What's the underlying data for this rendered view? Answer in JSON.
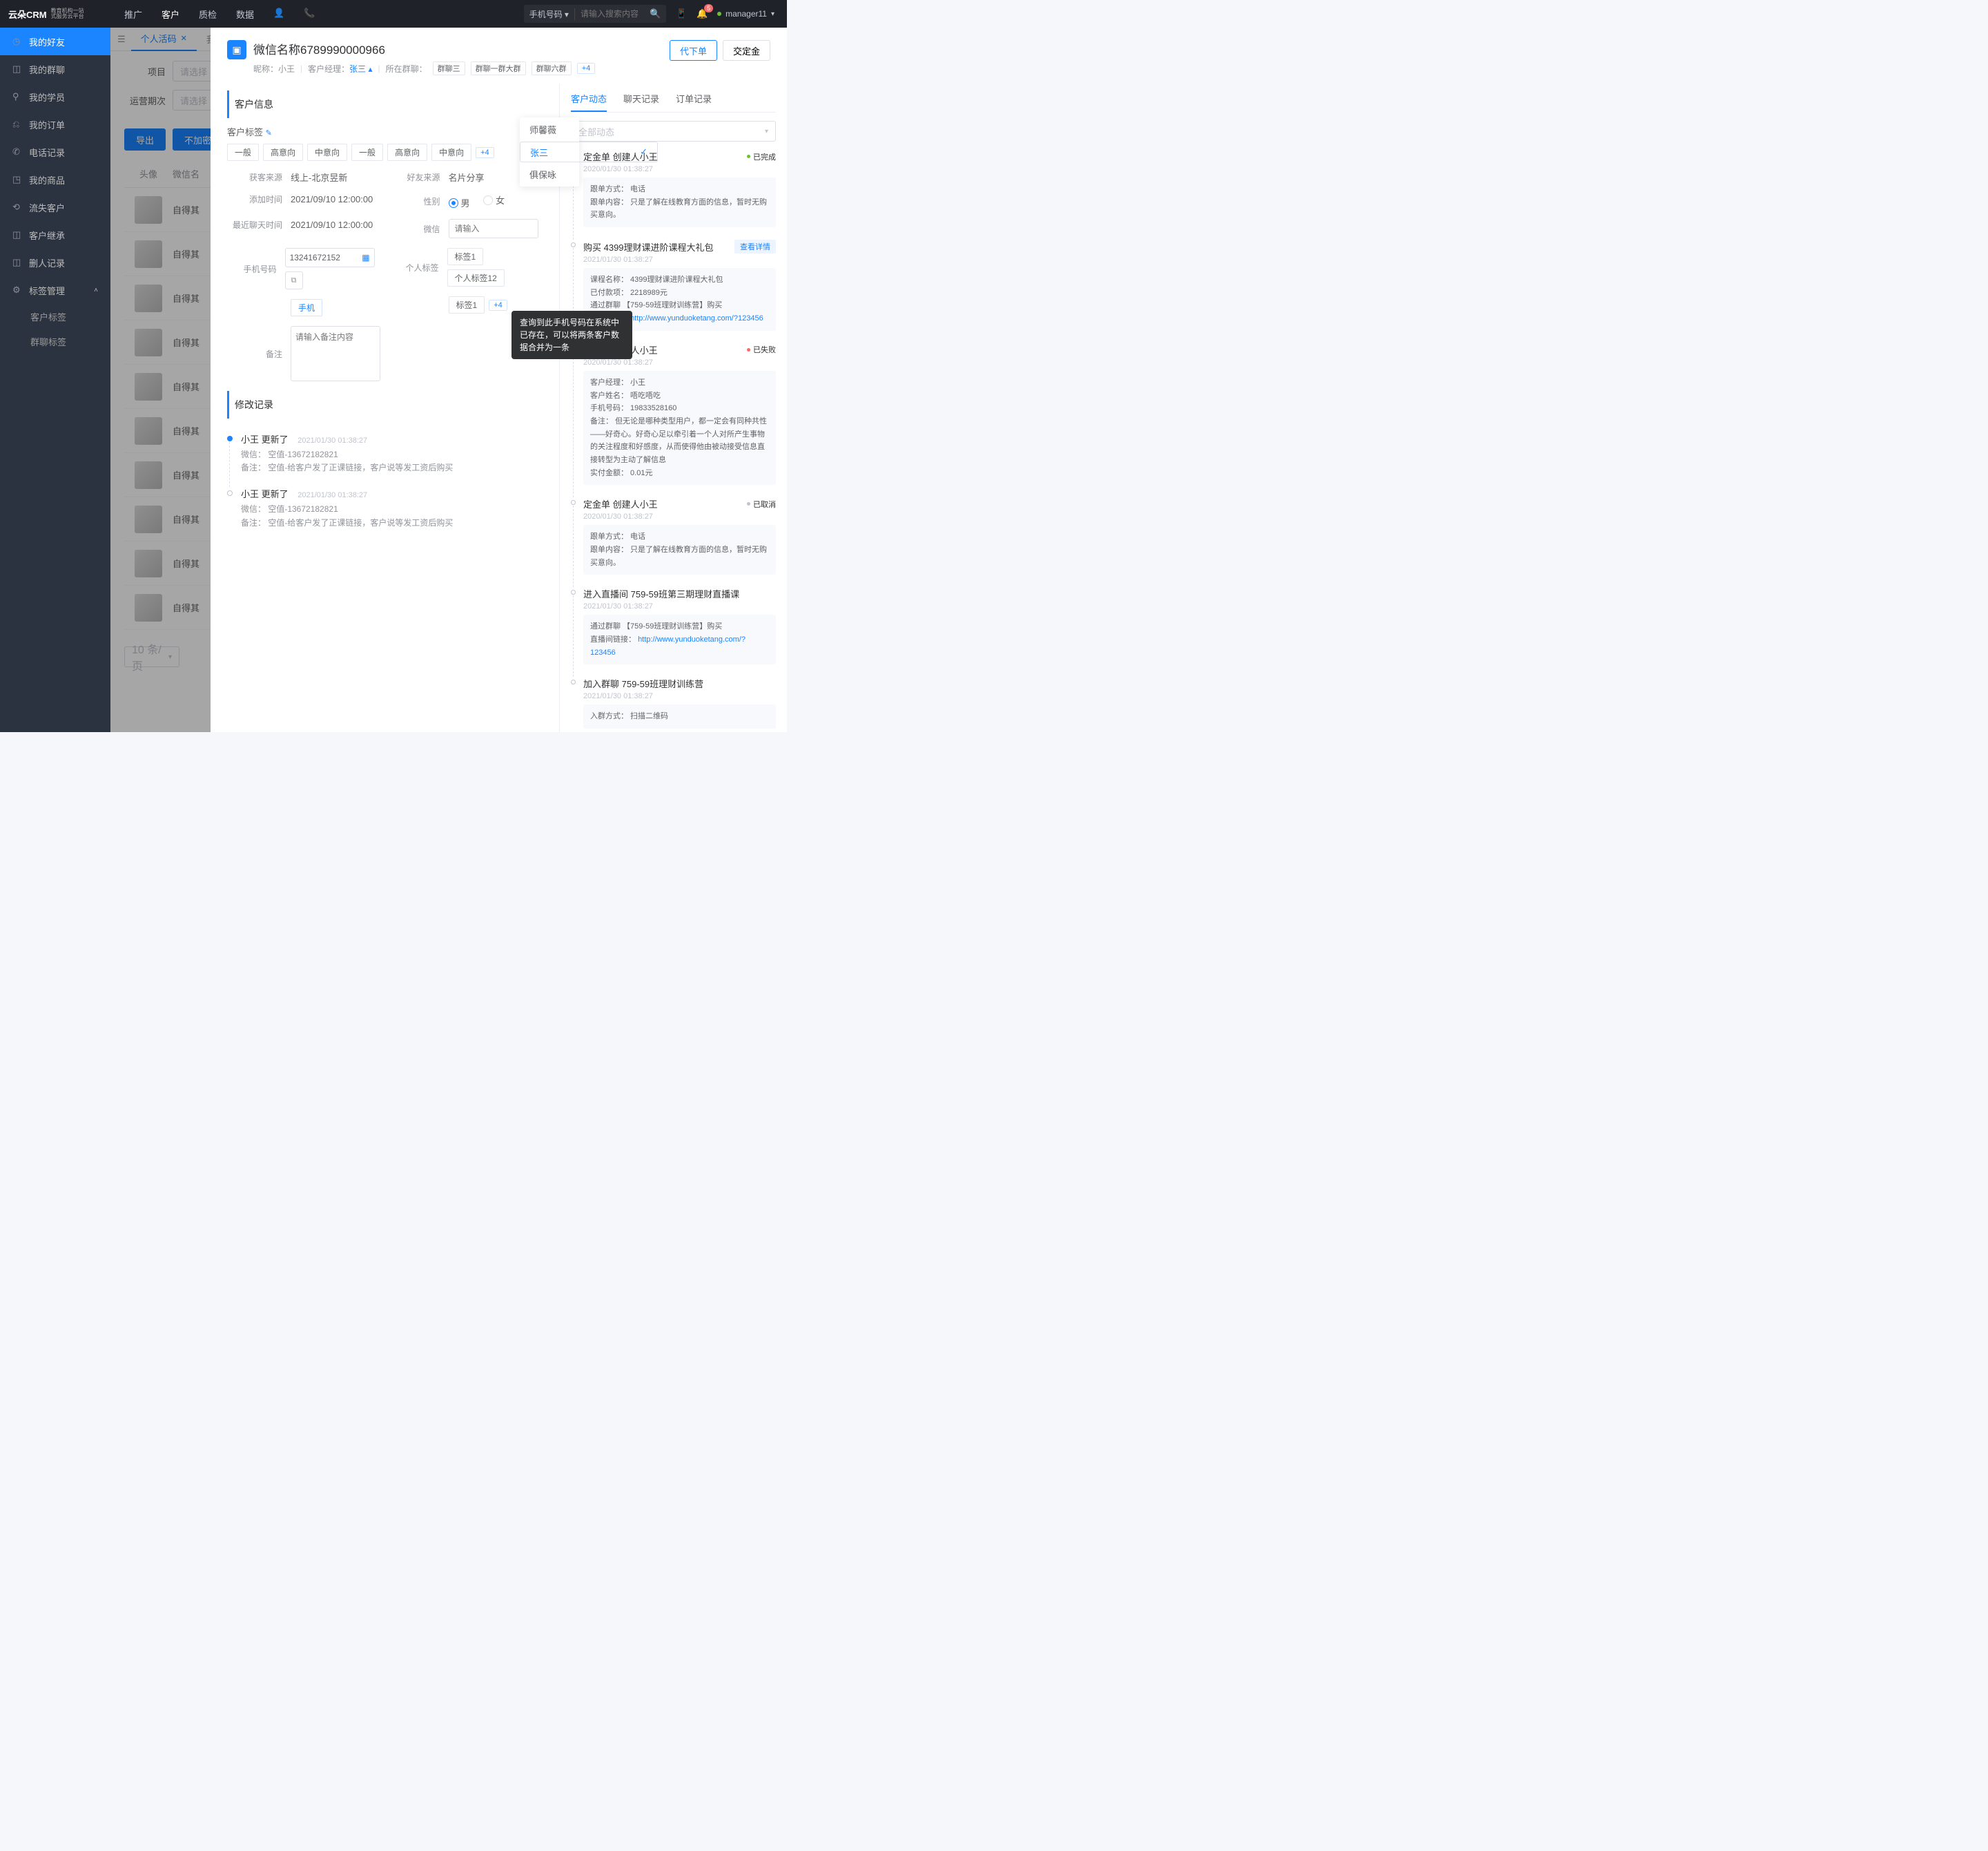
{
  "topbar": {
    "logo": "云朵CRM",
    "logo_sub1": "教育机构一站",
    "logo_sub2": "式服务云平台",
    "nav": [
      "推广",
      "客户",
      "质检",
      "数据"
    ],
    "activeNav": 1,
    "search_type": "手机号码",
    "search_ph": "请输入搜索内容",
    "badge": "5",
    "user": "manager11"
  },
  "sidebar": {
    "items": [
      "我的好友",
      "我的群聊",
      "我的学员",
      "我的订单",
      "电话记录",
      "我的商品",
      "流失客户",
      "客户继承",
      "删人记录",
      "标签管理"
    ],
    "sub": [
      "客户标签",
      "群聊标签"
    ]
  },
  "tabs": {
    "active": "个人活码",
    "other": "我"
  },
  "filters": {
    "proj": "项目",
    "proj_ph": "请选择",
    "period": "运营期次",
    "period_ph": "请选择"
  },
  "btns": {
    "export": "导出",
    "unencrypt": "不加密导出"
  },
  "table": {
    "h1": "头像",
    "h2": "微信名",
    "cell": "自得其",
    "pager": "10 条/页"
  },
  "drawer": {
    "title": "微信名称6789990000966",
    "nick_l": "昵称：",
    "nick": "小王",
    "mgr_l": "客户经理：",
    "mgr": "张三",
    "grp_l": "所在群聊：",
    "groups": [
      "群聊三",
      "群聊一群大群",
      "群聊六群"
    ],
    "grp_more": "+4",
    "btn1": "代下单",
    "btn2": "交定金",
    "sect1": "客户信息",
    "tags_l": "客户标签",
    "tags": [
      "一般",
      "高意向",
      "中意向",
      "一般",
      "高意向",
      "中意向"
    ],
    "tags_more": "+4",
    "src_l": "获客来源",
    "src": "线上-北京昱新",
    "friend_l": "好友来源",
    "friend": "名片分享",
    "add_l": "添加时间",
    "add": "2021/09/10 12:00:00",
    "gender_l": "性别",
    "male": "男",
    "female": "女",
    "last_l": "最近聊天时间",
    "last": "2021/09/10 12:00:00",
    "wx_l": "微信",
    "wx_ph": "请输入",
    "phone_l": "手机号码",
    "phone": "13241672152",
    "phone_btn": "手机",
    "ptag_l": "个人标签",
    "ptags": [
      "标签1",
      "个人标签12",
      "标签1"
    ],
    "ptag_more": "+4",
    "remark_l": "备注",
    "remark_ph": "请输入备注内容",
    "tooltip": "查询到此手机号码在系统中已存在，可以将两条客户数据合并为一条",
    "dd": [
      "师馨薇",
      "张三",
      "俱保咏"
    ],
    "sect2": "修改记录",
    "log": [
      {
        "t": "小王 更新了",
        "d": "2021/01/30  01:38:27",
        "b": [
          "微信： 空值-13672182821",
          "备注： 空值-给客户发了正课链接，客户说等发工资后购买"
        ]
      },
      {
        "t": "小王 更新了",
        "d": "2021/01/30  01:38:27",
        "b": [
          "微信： 空值-13672182821",
          "备注： 空值-给客户发了正课链接，客户说等发工资后购买"
        ]
      }
    ]
  },
  "right": {
    "tabs": [
      "客户动态",
      "聊天记录",
      "订单记录"
    ],
    "filter": "全部动态",
    "detail": "查看详情",
    "feed": [
      {
        "dot": "solid",
        "title": "定金单 创建人小王",
        "status": "已完成",
        "color": "#67c23a",
        "date": "2020/01/30  01:38:27",
        "card": [
          "跟单方式： 电话",
          "跟单内容： 只是了解在线教育方面的信息，暂时无购买意向。"
        ]
      },
      {
        "dot": "hollow",
        "title": "购买 4399理财课进阶课程大礼包",
        "date": "2021/01/30  01:38:27",
        "detail": true,
        "card": [
          "课程名称： 4399理财课进阶课程大礼包",
          "已付款项： 2218989元",
          "通过群聊 【759-59班理财训练营】购买",
          "课程链接： http://www.yunduoketang.com/?123456"
        ]
      },
      {
        "dot": "hollow",
        "title": "报名单 创建人小王",
        "status": "已失败",
        "color": "#f56c6c",
        "date": "2020/01/30  01:38:27",
        "card": [
          "客户经理： 小王",
          "客户姓名： 唔吃唔吃",
          "手机号码： 19833528160",
          "备注： 但无论是哪种类型用户，都一定会有同种共性——好奇心。好奇心足以牵引着一个人对所产生事物的关注程度和好感度，从而使得他由被动接受信息直接转型为主动了解信息",
          "实付金额： 0.01元"
        ]
      },
      {
        "dot": "hollow",
        "title": "定金单 创建人小王",
        "status": "已取消",
        "color": "#c0c4cc",
        "date": "2020/01/30  01:38:27",
        "card": [
          "跟单方式： 电话",
          "跟单内容： 只是了解在线教育方面的信息，暂时无购买意向。"
        ]
      },
      {
        "dot": "hollow",
        "title": "进入直播间 759-59班第三期理财直播课",
        "date": "2021/01/30  01:38:27",
        "card": [
          "通过群聊 【759-59班理财训练营】购买",
          "直播间链接： http://www.yunduoketang.com/?123456"
        ]
      },
      {
        "dot": "hollow",
        "title": "加入群聊 759-59班理财训练营",
        "date": "2021/01/30  01:38:27",
        "card": [
          "入群方式： 扫描二维码"
        ]
      }
    ]
  }
}
